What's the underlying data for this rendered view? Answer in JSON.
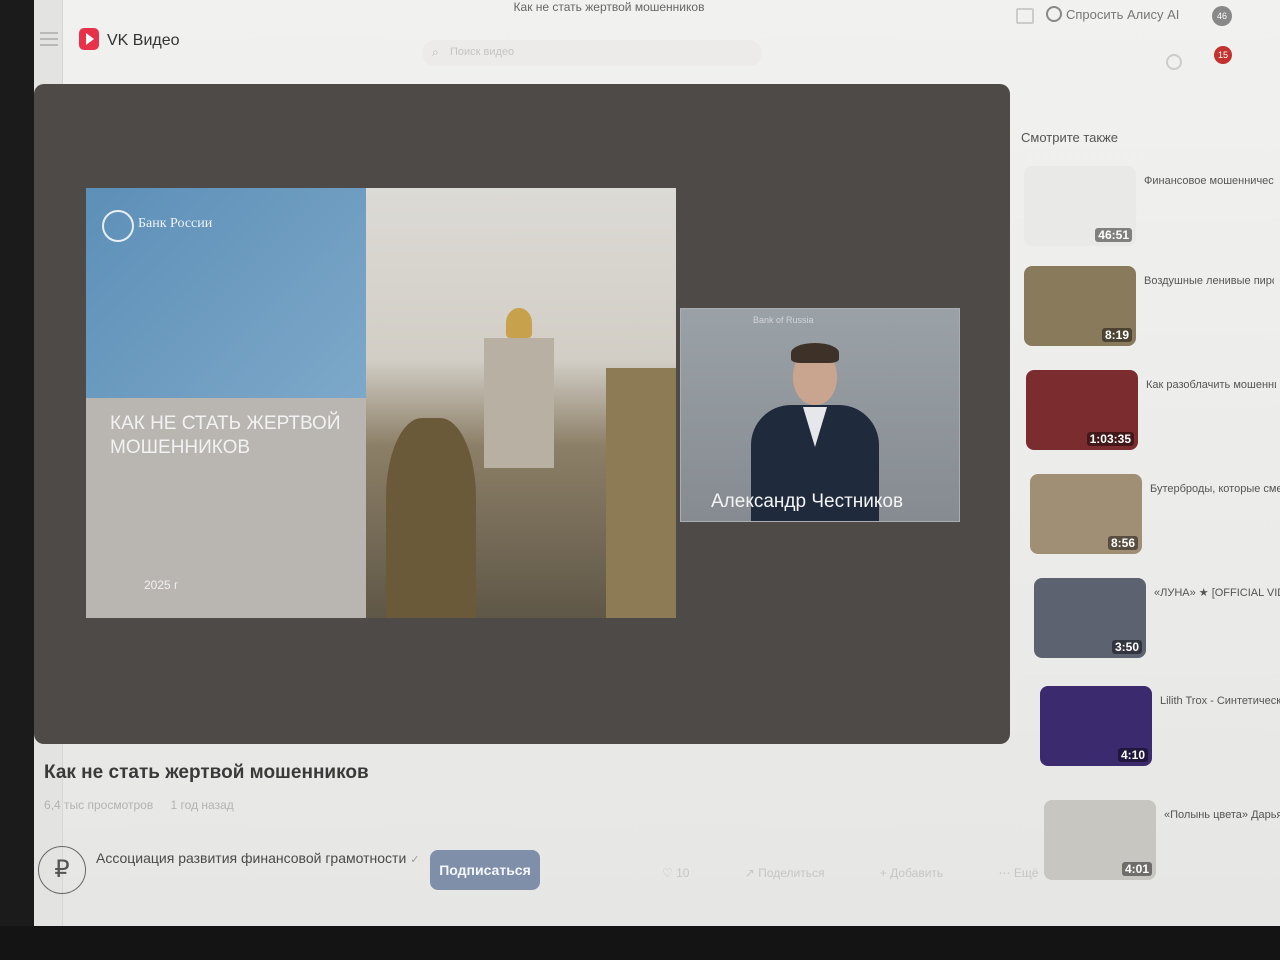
{
  "browser": {
    "tab_title": "Как не стать жертвой мошенников"
  },
  "header": {
    "brand": "VK Видео",
    "search_placeholder": "Поиск видео",
    "ask_alice": "Спросить Алису AI",
    "avatar_badge": "46",
    "notifications_count": "15"
  },
  "slide": {
    "bank_name": "Банк России",
    "title": "Как не стать жертвой мошенников",
    "year": "2025 г"
  },
  "speaker": {
    "caption": "Александр Честников",
    "watermark": "Bank of Russia"
  },
  "video": {
    "title": "Как не стать жертвой мошенников",
    "views": "6,4 тыс просмотров",
    "age": "1 год назад",
    "channel": "Ассоциация развития финансовой грамотности",
    "subscribe_label": "Подписаться",
    "actions": {
      "like": "10",
      "share": "Поделиться",
      "add": "Добавить",
      "more": "Ещё"
    }
  },
  "rail": {
    "heading": "Смотрите также",
    "items": [
      {
        "title": "Финансовое мошенничество в...",
        "duration": "46:51",
        "thumb_color": "#e9e9e7"
      },
      {
        "title": "Воздушные ленивые пирожки с фруктами",
        "duration": "8:19",
        "thumb_color": "#8a7a5c"
      },
      {
        "title": "Как разоблачить мошенника, и когда ИИ",
        "duration": "1:03:35",
        "thumb_color": "#7b2c2f"
      },
      {
        "title": "Бутерброды, которые сметали за считаные",
        "duration": "8:56",
        "thumb_color": "#a08f74"
      },
      {
        "title": "«ЛУНА» ★ [OFFICIAL VIDEO]",
        "duration": "3:50",
        "thumb_color": "#5c6270"
      },
      {
        "title": "Lilith Trox - Синтетическая вода (Все включено",
        "duration": "4:10",
        "thumb_color": "#3c2a6e"
      },
      {
        "title": "«Полынь цвета» Дарья Котова | Пр",
        "duration": "4:01",
        "thumb_color": "#c8c6c0"
      }
    ]
  }
}
